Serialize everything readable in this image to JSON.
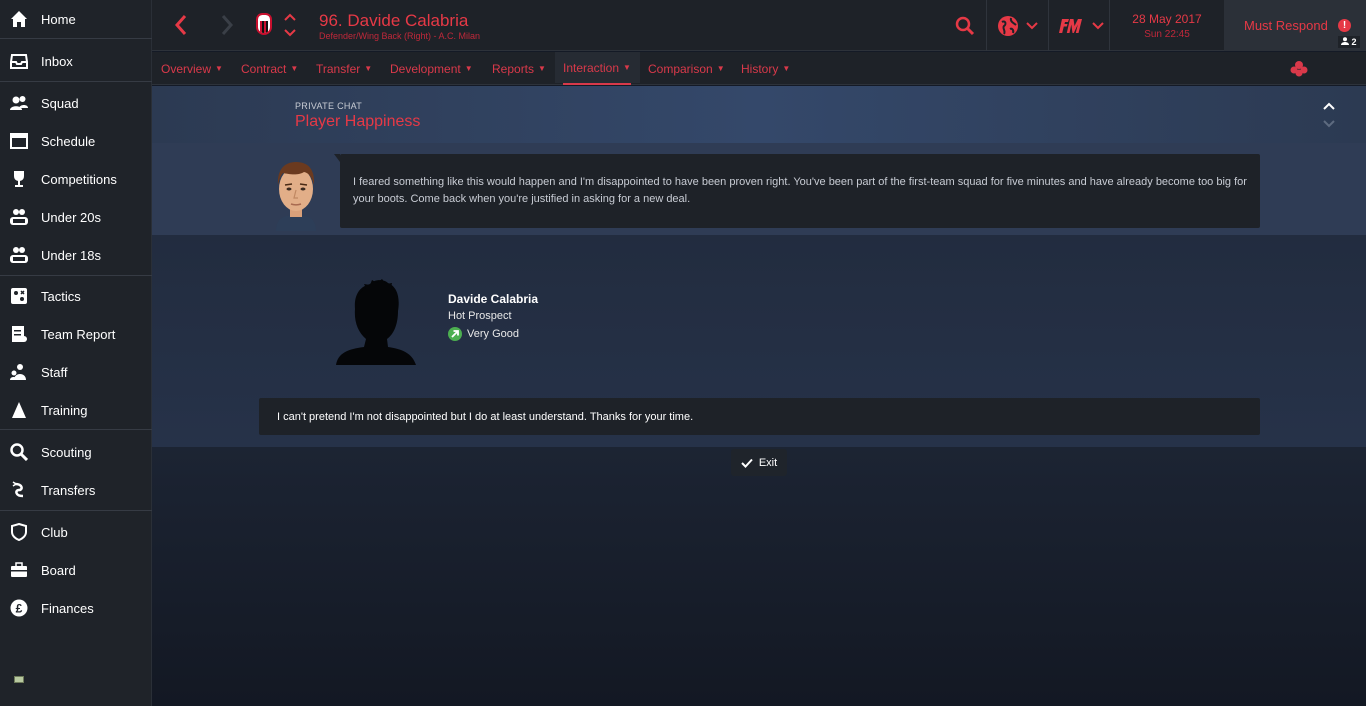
{
  "sidebar": {
    "items": [
      {
        "label": "Home",
        "icon": "home-icon"
      },
      {
        "label": "Inbox",
        "icon": "inbox-icon"
      },
      {
        "label": "Squad",
        "icon": "squad-icon"
      },
      {
        "label": "Schedule",
        "icon": "schedule-icon"
      },
      {
        "label": "Competitions",
        "icon": "trophy-icon"
      },
      {
        "label": "Under 20s",
        "icon": "under20s-icon"
      },
      {
        "label": "Under 18s",
        "icon": "under18s-icon"
      },
      {
        "label": "Tactics",
        "icon": "tactics-icon"
      },
      {
        "label": "Team Report",
        "icon": "report-icon"
      },
      {
        "label": "Staff",
        "icon": "staff-icon"
      },
      {
        "label": "Training",
        "icon": "training-icon"
      },
      {
        "label": "Scouting",
        "icon": "search-icon"
      },
      {
        "label": "Transfers",
        "icon": "transfers-icon"
      },
      {
        "label": "Club",
        "icon": "shield-icon"
      },
      {
        "label": "Board",
        "icon": "briefcase-icon"
      },
      {
        "label": "Finances",
        "icon": "pound-icon"
      }
    ]
  },
  "header": {
    "player_title": "96. Davide Calabria",
    "player_subtitle": "Defender/Wing Back (Right) - A.C. Milan",
    "date": "28 May 2017",
    "time": "Sun 22:45",
    "must_respond": "Must Respond",
    "alert_mark": "!",
    "pending_count": "2"
  },
  "tabs": [
    {
      "label": "Overview"
    },
    {
      "label": "Contract"
    },
    {
      "label": "Transfer"
    },
    {
      "label": "Development"
    },
    {
      "label": "Reports"
    },
    {
      "label": "Interaction"
    },
    {
      "label": "Comparison"
    },
    {
      "label": "History"
    }
  ],
  "banner": {
    "overline": "PRIVATE CHAT",
    "title": "Player Happiness"
  },
  "chat": {
    "manager_message": "I feared something like this would happen and I'm disappointed to have been proven right. You've been part of the first-team squad for five minutes and have already become too big for your boots. Come back when you're justified in asking for a new deal.",
    "player_name": "Davide Calabria",
    "player_status": "Hot Prospect",
    "player_morale": "Very Good",
    "player_reply": "I can't pretend I'm not disappointed but I do at least understand. Thanks for your time.",
    "exit_label": "Exit"
  },
  "colors": {
    "accent": "#e63946",
    "sidebar_bg": "#1f2329",
    "banner_bg": "#34486a",
    "morale_green": "#4caf50"
  }
}
